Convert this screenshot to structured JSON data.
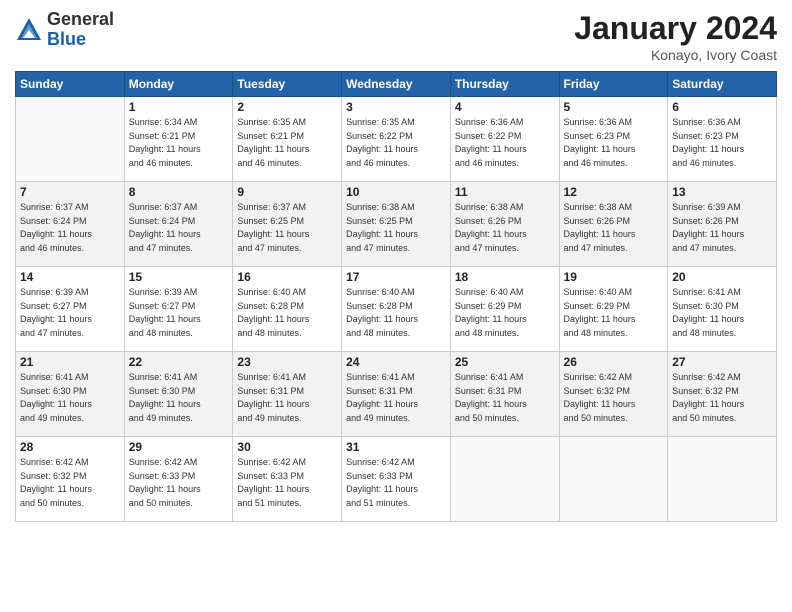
{
  "header": {
    "logo_general": "General",
    "logo_blue": "Blue",
    "month_title": "January 2024",
    "location": "Konayo, Ivory Coast"
  },
  "weekdays": [
    "Sunday",
    "Monday",
    "Tuesday",
    "Wednesday",
    "Thursday",
    "Friday",
    "Saturday"
  ],
  "weeks": [
    [
      {
        "day": "",
        "info": ""
      },
      {
        "day": "1",
        "info": "Sunrise: 6:34 AM\nSunset: 6:21 PM\nDaylight: 11 hours\nand 46 minutes."
      },
      {
        "day": "2",
        "info": "Sunrise: 6:35 AM\nSunset: 6:21 PM\nDaylight: 11 hours\nand 46 minutes."
      },
      {
        "day": "3",
        "info": "Sunrise: 6:35 AM\nSunset: 6:22 PM\nDaylight: 11 hours\nand 46 minutes."
      },
      {
        "day": "4",
        "info": "Sunrise: 6:36 AM\nSunset: 6:22 PM\nDaylight: 11 hours\nand 46 minutes."
      },
      {
        "day": "5",
        "info": "Sunrise: 6:36 AM\nSunset: 6:23 PM\nDaylight: 11 hours\nand 46 minutes."
      },
      {
        "day": "6",
        "info": "Sunrise: 6:36 AM\nSunset: 6:23 PM\nDaylight: 11 hours\nand 46 minutes."
      }
    ],
    [
      {
        "day": "7",
        "info": "Sunrise: 6:37 AM\nSunset: 6:24 PM\nDaylight: 11 hours\nand 46 minutes."
      },
      {
        "day": "8",
        "info": "Sunrise: 6:37 AM\nSunset: 6:24 PM\nDaylight: 11 hours\nand 47 minutes."
      },
      {
        "day": "9",
        "info": "Sunrise: 6:37 AM\nSunset: 6:25 PM\nDaylight: 11 hours\nand 47 minutes."
      },
      {
        "day": "10",
        "info": "Sunrise: 6:38 AM\nSunset: 6:25 PM\nDaylight: 11 hours\nand 47 minutes."
      },
      {
        "day": "11",
        "info": "Sunrise: 6:38 AM\nSunset: 6:26 PM\nDaylight: 11 hours\nand 47 minutes."
      },
      {
        "day": "12",
        "info": "Sunrise: 6:38 AM\nSunset: 6:26 PM\nDaylight: 11 hours\nand 47 minutes."
      },
      {
        "day": "13",
        "info": "Sunrise: 6:39 AM\nSunset: 6:26 PM\nDaylight: 11 hours\nand 47 minutes."
      }
    ],
    [
      {
        "day": "14",
        "info": "Sunrise: 6:39 AM\nSunset: 6:27 PM\nDaylight: 11 hours\nand 47 minutes."
      },
      {
        "day": "15",
        "info": "Sunrise: 6:39 AM\nSunset: 6:27 PM\nDaylight: 11 hours\nand 48 minutes."
      },
      {
        "day": "16",
        "info": "Sunrise: 6:40 AM\nSunset: 6:28 PM\nDaylight: 11 hours\nand 48 minutes."
      },
      {
        "day": "17",
        "info": "Sunrise: 6:40 AM\nSunset: 6:28 PM\nDaylight: 11 hours\nand 48 minutes."
      },
      {
        "day": "18",
        "info": "Sunrise: 6:40 AM\nSunset: 6:29 PM\nDaylight: 11 hours\nand 48 minutes."
      },
      {
        "day": "19",
        "info": "Sunrise: 6:40 AM\nSunset: 6:29 PM\nDaylight: 11 hours\nand 48 minutes."
      },
      {
        "day": "20",
        "info": "Sunrise: 6:41 AM\nSunset: 6:30 PM\nDaylight: 11 hours\nand 48 minutes."
      }
    ],
    [
      {
        "day": "21",
        "info": "Sunrise: 6:41 AM\nSunset: 6:30 PM\nDaylight: 11 hours\nand 49 minutes."
      },
      {
        "day": "22",
        "info": "Sunrise: 6:41 AM\nSunset: 6:30 PM\nDaylight: 11 hours\nand 49 minutes."
      },
      {
        "day": "23",
        "info": "Sunrise: 6:41 AM\nSunset: 6:31 PM\nDaylight: 11 hours\nand 49 minutes."
      },
      {
        "day": "24",
        "info": "Sunrise: 6:41 AM\nSunset: 6:31 PM\nDaylight: 11 hours\nand 49 minutes."
      },
      {
        "day": "25",
        "info": "Sunrise: 6:41 AM\nSunset: 6:31 PM\nDaylight: 11 hours\nand 50 minutes."
      },
      {
        "day": "26",
        "info": "Sunrise: 6:42 AM\nSunset: 6:32 PM\nDaylight: 11 hours\nand 50 minutes."
      },
      {
        "day": "27",
        "info": "Sunrise: 6:42 AM\nSunset: 6:32 PM\nDaylight: 11 hours\nand 50 minutes."
      }
    ],
    [
      {
        "day": "28",
        "info": "Sunrise: 6:42 AM\nSunset: 6:32 PM\nDaylight: 11 hours\nand 50 minutes."
      },
      {
        "day": "29",
        "info": "Sunrise: 6:42 AM\nSunset: 6:33 PM\nDaylight: 11 hours\nand 50 minutes."
      },
      {
        "day": "30",
        "info": "Sunrise: 6:42 AM\nSunset: 6:33 PM\nDaylight: 11 hours\nand 51 minutes."
      },
      {
        "day": "31",
        "info": "Sunrise: 6:42 AM\nSunset: 6:33 PM\nDaylight: 11 hours\nand 51 minutes."
      },
      {
        "day": "",
        "info": ""
      },
      {
        "day": "",
        "info": ""
      },
      {
        "day": "",
        "info": ""
      }
    ]
  ]
}
